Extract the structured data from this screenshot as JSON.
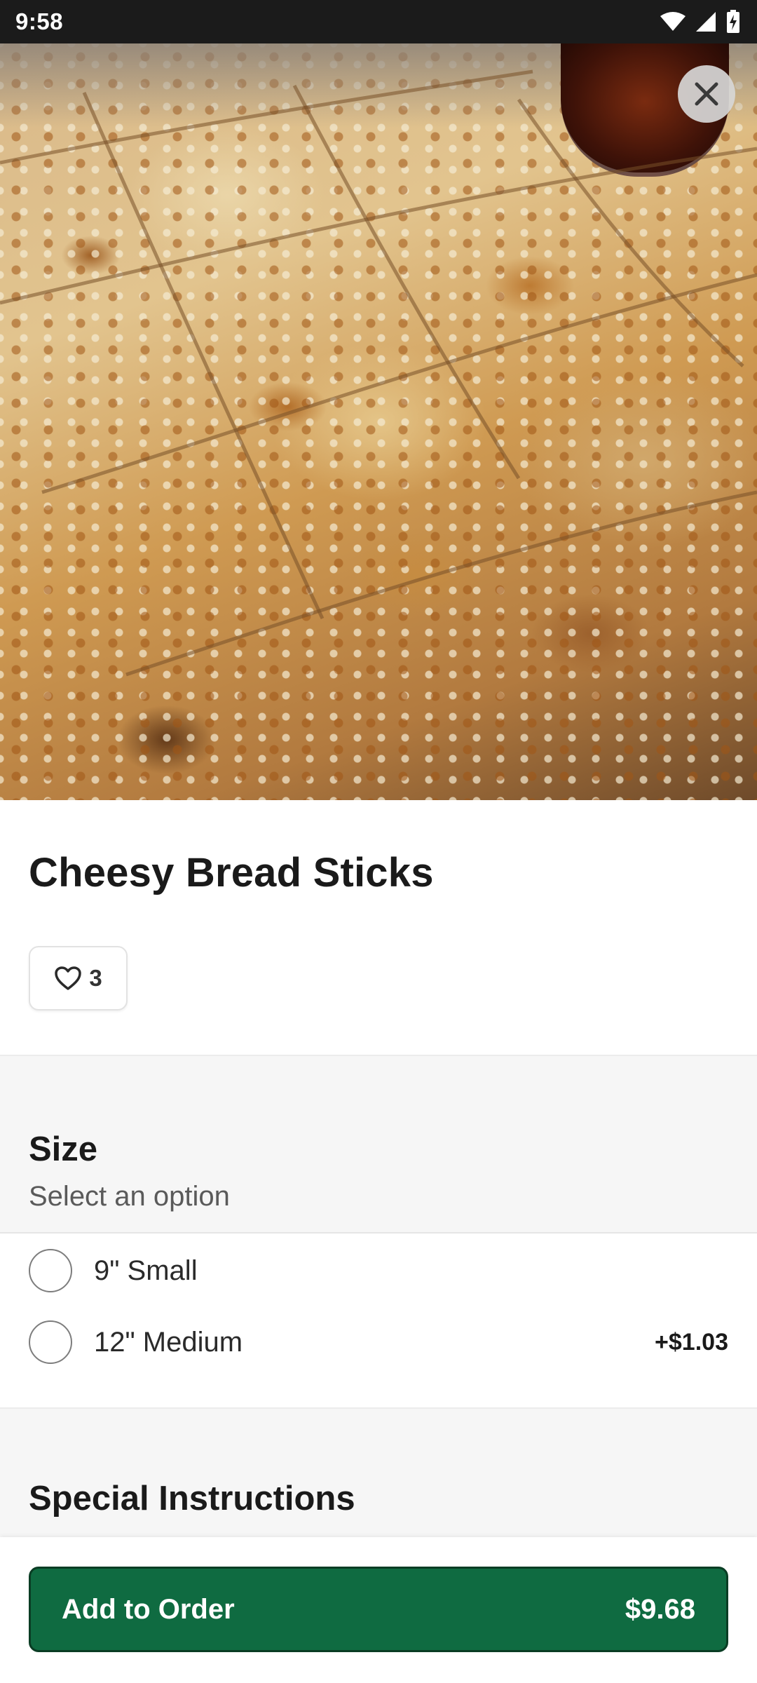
{
  "status_bar": {
    "time": "9:58"
  },
  "item": {
    "title": "Cheesy Bread Sticks",
    "likes": "3"
  },
  "size_section": {
    "title": "Size",
    "subtitle": "Select an option",
    "options": [
      {
        "label": "9\" Small",
        "price": ""
      },
      {
        "label": "12\" Medium",
        "price": "+$1.03"
      }
    ]
  },
  "special_instructions": {
    "title": "Special Instructions"
  },
  "bottom_bar": {
    "button_label": "Add to Order",
    "total": "$9.68"
  },
  "colors": {
    "accent_green": "#0f6b41",
    "status_bar_bg": "#1b1b1b",
    "section_bg": "#f6f6f6"
  }
}
